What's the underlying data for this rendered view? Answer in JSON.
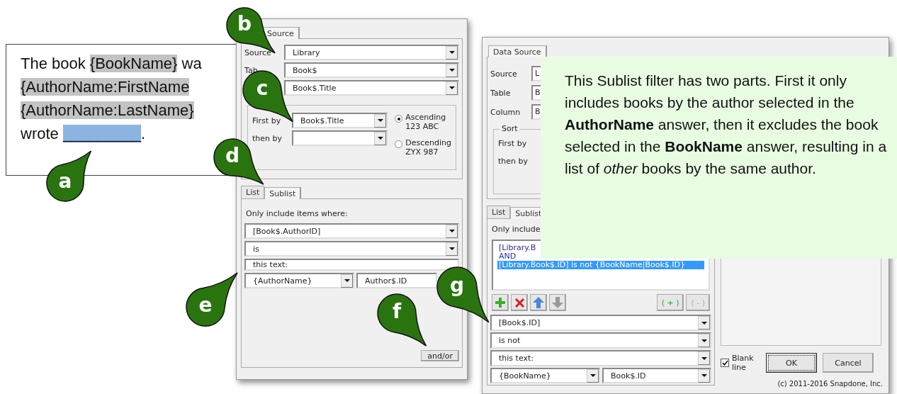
{
  "document": {
    "lines": [
      [
        {
          "text": "The book ",
          "kind": "plain"
        },
        {
          "text": "{BookName}",
          "kind": "field"
        },
        {
          "text": " wa",
          "kind": "plain"
        }
      ],
      [
        {
          "text": "{AuthorName:FirstName",
          "kind": "field"
        }
      ],
      [
        {
          "text": "{AuthorName:LastName}",
          "kind": "field"
        }
      ],
      [
        {
          "text": "wrote ",
          "kind": "plain"
        },
        {
          "text": "_________",
          "kind": "answer"
        },
        {
          "text": ".",
          "kind": "plain"
        }
      ]
    ]
  },
  "window_back": {
    "tabs_top": [
      {
        "label": "Source",
        "selected": true
      }
    ],
    "source_rows": [
      {
        "label": "Source",
        "value": "Library"
      },
      {
        "label": "Tab",
        "value": "Book$"
      },
      {
        "value": "Book$.Title"
      }
    ],
    "sort": {
      "rows": [
        {
          "label": "First by",
          "value": "Book$.Title"
        },
        {
          "label": "then by"
        }
      ],
      "order": [
        {
          "label": "Ascending",
          "sub": "123 ABC",
          "selected": true
        },
        {
          "label": "Descending",
          "sub": "ZYX 987",
          "selected": false
        }
      ]
    },
    "tabs": [
      {
        "label": "List",
        "selected": false
      },
      {
        "label": "Sublist",
        "selected": true
      }
    ],
    "filter_label": "Only include items where:",
    "fields": [
      {
        "value": "[Book$.AuthorID]",
        "dropdown": true
      },
      {
        "value": "is",
        "dropdown": true
      },
      {
        "value": "this text:",
        "dropdown": false
      }
    ],
    "field_pair": [
      {
        "value": "{AuthorName}",
        "dropdown": true
      },
      {
        "value": "Author$.ID",
        "dropdown": false
      }
    ],
    "buttons": [
      {
        "label": "and/or"
      }
    ]
  },
  "window_front": {
    "tabs_top": [
      {
        "label": "Data Source",
        "selected": true
      }
    ],
    "source_rows": [
      {
        "label": "Source",
        "value": "L"
      },
      {
        "label": "Table",
        "value": "B"
      },
      {
        "label": "Column",
        "value": "B"
      }
    ],
    "sort": {
      "legend": "Sort",
      "rows": [
        {
          "label": "First by"
        },
        {
          "label": "then by"
        }
      ]
    },
    "tabs": [
      {
        "label": "List",
        "selected": false
      },
      {
        "label": "Sublist",
        "selected": true
      }
    ],
    "filter_label": "Only include",
    "conditions": [
      {
        "text": "[Library.B",
        "selected": false
      },
      {
        "text": "AND",
        "selected": false
      },
      {
        "text": "[Library.Book$.ID] is not {BookName|Book$.ID}",
        "selected": true
      }
    ],
    "toolbar": [
      {
        "kind": "add",
        "disabled": false
      },
      {
        "kind": "delete",
        "disabled": false
      },
      {
        "kind": "up",
        "disabled": false
      },
      {
        "kind": "down",
        "disabled": true
      }
    ],
    "group_buttons": [
      {
        "label": "( + )",
        "disabled": false
      },
      {
        "label": "( - )",
        "disabled": true
      }
    ],
    "fields": [
      {
        "value": "[Book$.ID]",
        "dropdown": true
      },
      {
        "value": "is not",
        "dropdown": true
      },
      {
        "value": "this text:",
        "dropdown": true
      }
    ],
    "field_pair": [
      {
        "value": "{BookName}",
        "dropdown": true
      },
      {
        "value": "Book$.ID",
        "dropdown": true
      }
    ],
    "blank_line": {
      "label": "Blank line",
      "checked": true
    },
    "buttons": [
      {
        "label": "OK",
        "default": true
      },
      {
        "label": "Cancel",
        "default": false
      }
    ],
    "copyright": "(c) 2011-2016 Snapdone, Inc."
  },
  "note": {
    "text": "This Sublist filter has two parts. First it only includes books by the author selected in the **AuthorName** answer, then it excludes the book selected in the **BookName** answer, resulting in a list of *other* books by the same author."
  },
  "callouts": [
    {
      "label": "a"
    },
    {
      "label": "b"
    },
    {
      "label": "c"
    },
    {
      "label": "d"
    },
    {
      "label": "e"
    },
    {
      "label": "f"
    },
    {
      "label": "g"
    }
  ]
}
